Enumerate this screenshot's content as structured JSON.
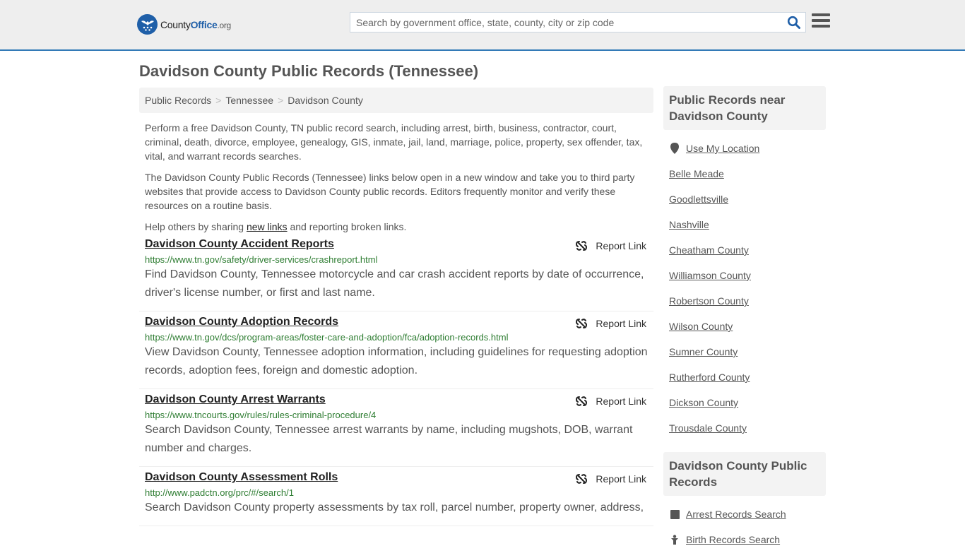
{
  "header": {
    "logo": {
      "name": "County",
      "name_bold": "Office",
      "tld": ".org"
    },
    "search": {
      "placeholder": "Search by government office, state, county, city or zip code",
      "value": ""
    },
    "colors": {
      "accent": "#337ab7",
      "brand": "#1f5fa8"
    }
  },
  "page": {
    "title": "Davidson County Public Records (Tennessee)"
  },
  "breadcrumb": [
    {
      "label": "Public Records"
    },
    {
      "label": "Tennessee"
    },
    {
      "label": "Davidson County"
    }
  ],
  "breadcrumb_separator": ">",
  "intro": {
    "p1": "Perform a free Davidson County, TN public record search, including arrest, birth, business, contractor, court, criminal, death, divorce, employee, genealogy, GIS, inmate, jail, land, marriage, police, property, sex offender, tax, vital, and warrant records searches.",
    "p2": "The Davidson County Public Records (Tennessee) links below open in a new window and take you to third party websites that provide access to Davidson County public records. Editors frequently monitor and verify these resources on a routine basis.",
    "p3_before": "Help others by sharing ",
    "p3_link": "new links",
    "p3_after": " and reporting broken links."
  },
  "report_link_label": "Report Link",
  "records": [
    {
      "title": "Davidson County Accident Reports",
      "url": "https://www.tn.gov/safety/driver-services/crashreport.html",
      "description": "Find Davidson County, Tennessee motorcycle and car crash accident reports by date of occurrence, driver's license number, or first and last name."
    },
    {
      "title": "Davidson County Adoption Records",
      "url": "https://www.tn.gov/dcs/program-areas/foster-care-and-adoption/fca/adoption-records.html",
      "description": "View Davidson County, Tennessee adoption information, including guidelines for requesting adoption records, adoption fees, foreign and domestic adoption."
    },
    {
      "title": "Davidson County Arrest Warrants",
      "url": "https://www.tncourts.gov/rules/rules-criminal-procedure/4",
      "description": "Search Davidson County, Tennessee arrest warrants by name, including mugshots, DOB, warrant number and charges."
    },
    {
      "title": "Davidson County Assessment Rolls",
      "url": "http://www.padctn.org/prc/#/search/1",
      "description": "Search Davidson County property assessments by tax roll, parcel number, property owner, address,"
    }
  ],
  "sidebar": {
    "nearby": {
      "heading": "Public Records near Davidson County",
      "use_location": "Use My Location",
      "items": [
        "Belle Meade",
        "Goodlettsville",
        "Nashville",
        "Cheatham County",
        "Williamson County",
        "Robertson County",
        "Wilson County",
        "Sumner County",
        "Rutherford County",
        "Dickson County",
        "Trousdale County"
      ]
    },
    "county_records": {
      "heading": "Davidson County Public Records",
      "items": [
        {
          "label": "Arrest Records Search",
          "icon": "square-icon"
        },
        {
          "label": "Birth Records Search",
          "icon": "baby-icon"
        }
      ]
    }
  }
}
